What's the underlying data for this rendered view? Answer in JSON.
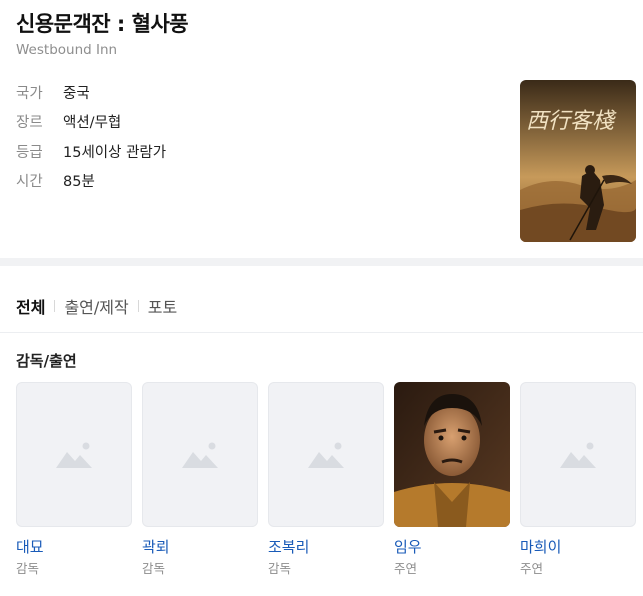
{
  "movie": {
    "title": "신용문객잔 : 혈사풍",
    "original_title": "Westbound Inn",
    "info": [
      {
        "label": "국가",
        "value": "중국"
      },
      {
        "label": "장르",
        "value": "액션/무협"
      },
      {
        "label": "등급",
        "value": "15세이상 관람가"
      },
      {
        "label": "시간",
        "value": "85분"
      }
    ],
    "poster_text": "西行客棧"
  },
  "tabs": [
    {
      "label": "전체",
      "active": true
    },
    {
      "label": "출연/제작",
      "active": false
    },
    {
      "label": "포토",
      "active": false
    }
  ],
  "section_title": "감독/출연",
  "people": [
    {
      "name": "대묘",
      "role": "감독",
      "has_photo": false
    },
    {
      "name": "곽뢰",
      "role": "감독",
      "has_photo": false
    },
    {
      "name": "조복리",
      "role": "감독",
      "has_photo": false
    },
    {
      "name": "임우",
      "role": "주연",
      "has_photo": true
    },
    {
      "name": "마희이",
      "role": "주연",
      "has_photo": false
    }
  ],
  "colors": {
    "link": "#1a5bb8",
    "muted": "#8e8e8e",
    "background": "#f1f2f4"
  }
}
